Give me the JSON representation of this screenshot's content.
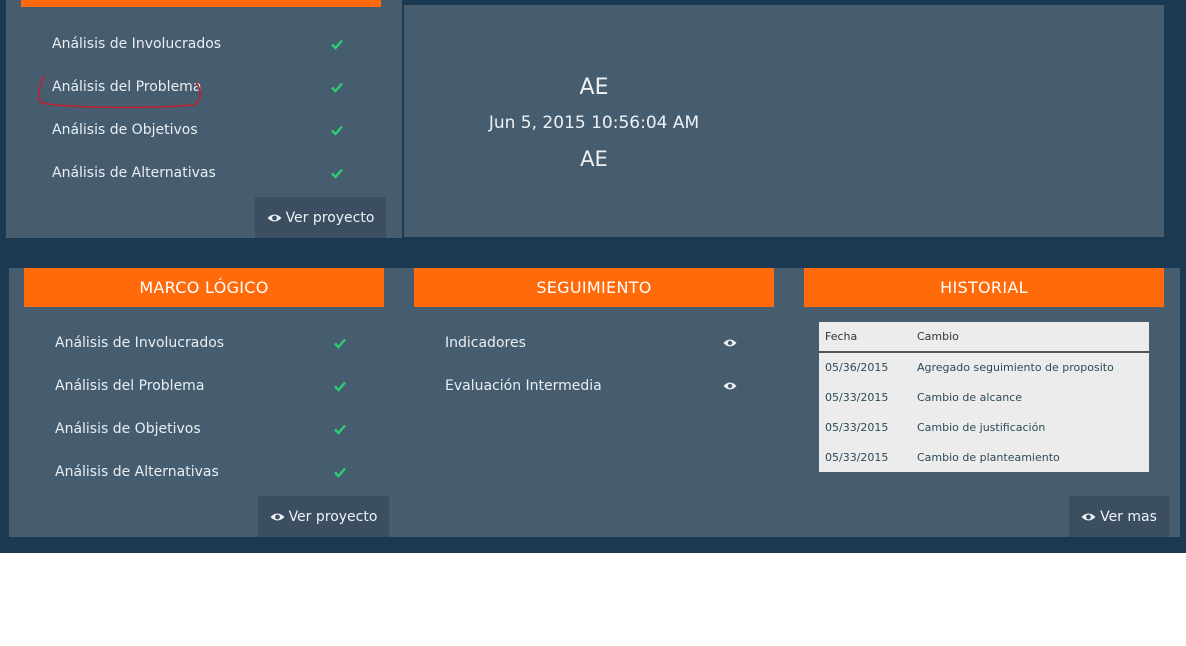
{
  "top_left_card": {
    "items": [
      {
        "label": "Análisis de Involucrados"
      },
      {
        "label": "Análisis del Problema"
      },
      {
        "label": "Análisis de Objetivos"
      },
      {
        "label": "Análisis de Alternativas"
      }
    ],
    "button_label": "Ver proyecto"
  },
  "top_info": {
    "line1": "AE",
    "datetime": "Jun 5, 2015 10:56:04 AM",
    "line3": "AE"
  },
  "marco_logico": {
    "title": "MARCO LÓGICO",
    "items": [
      {
        "label": "Análisis de Involucrados"
      },
      {
        "label": "Análisis del Problema"
      },
      {
        "label": "Análisis de Objetivos"
      },
      {
        "label": "Análisis de Alternativas"
      }
    ],
    "button_label": "Ver proyecto"
  },
  "seguimiento": {
    "title": "SEGUIMIENTO",
    "items": [
      {
        "label": "Indicadores"
      },
      {
        "label": "Evaluación Intermedia"
      }
    ]
  },
  "historial": {
    "title": "HISTORIAL",
    "columns": [
      "Fecha",
      "Cambio"
    ],
    "rows": [
      {
        "fecha": "05/36/2015",
        "cambio": "Agregado seguimiento de proposito"
      },
      {
        "fecha": "05/33/2015",
        "cambio": "Cambio de alcance"
      },
      {
        "fecha": "05/33/2015",
        "cambio": "Cambio de justificación"
      },
      {
        "fecha": "05/33/2015",
        "cambio": "Cambio de planteamiento"
      }
    ],
    "button_label": "Ver mas"
  },
  "colors": {
    "accent": "#ff6a0a",
    "panel": "#465d6f",
    "background": "#1b3a52",
    "check": "#2ecc71",
    "annotation": "#c0202a"
  }
}
